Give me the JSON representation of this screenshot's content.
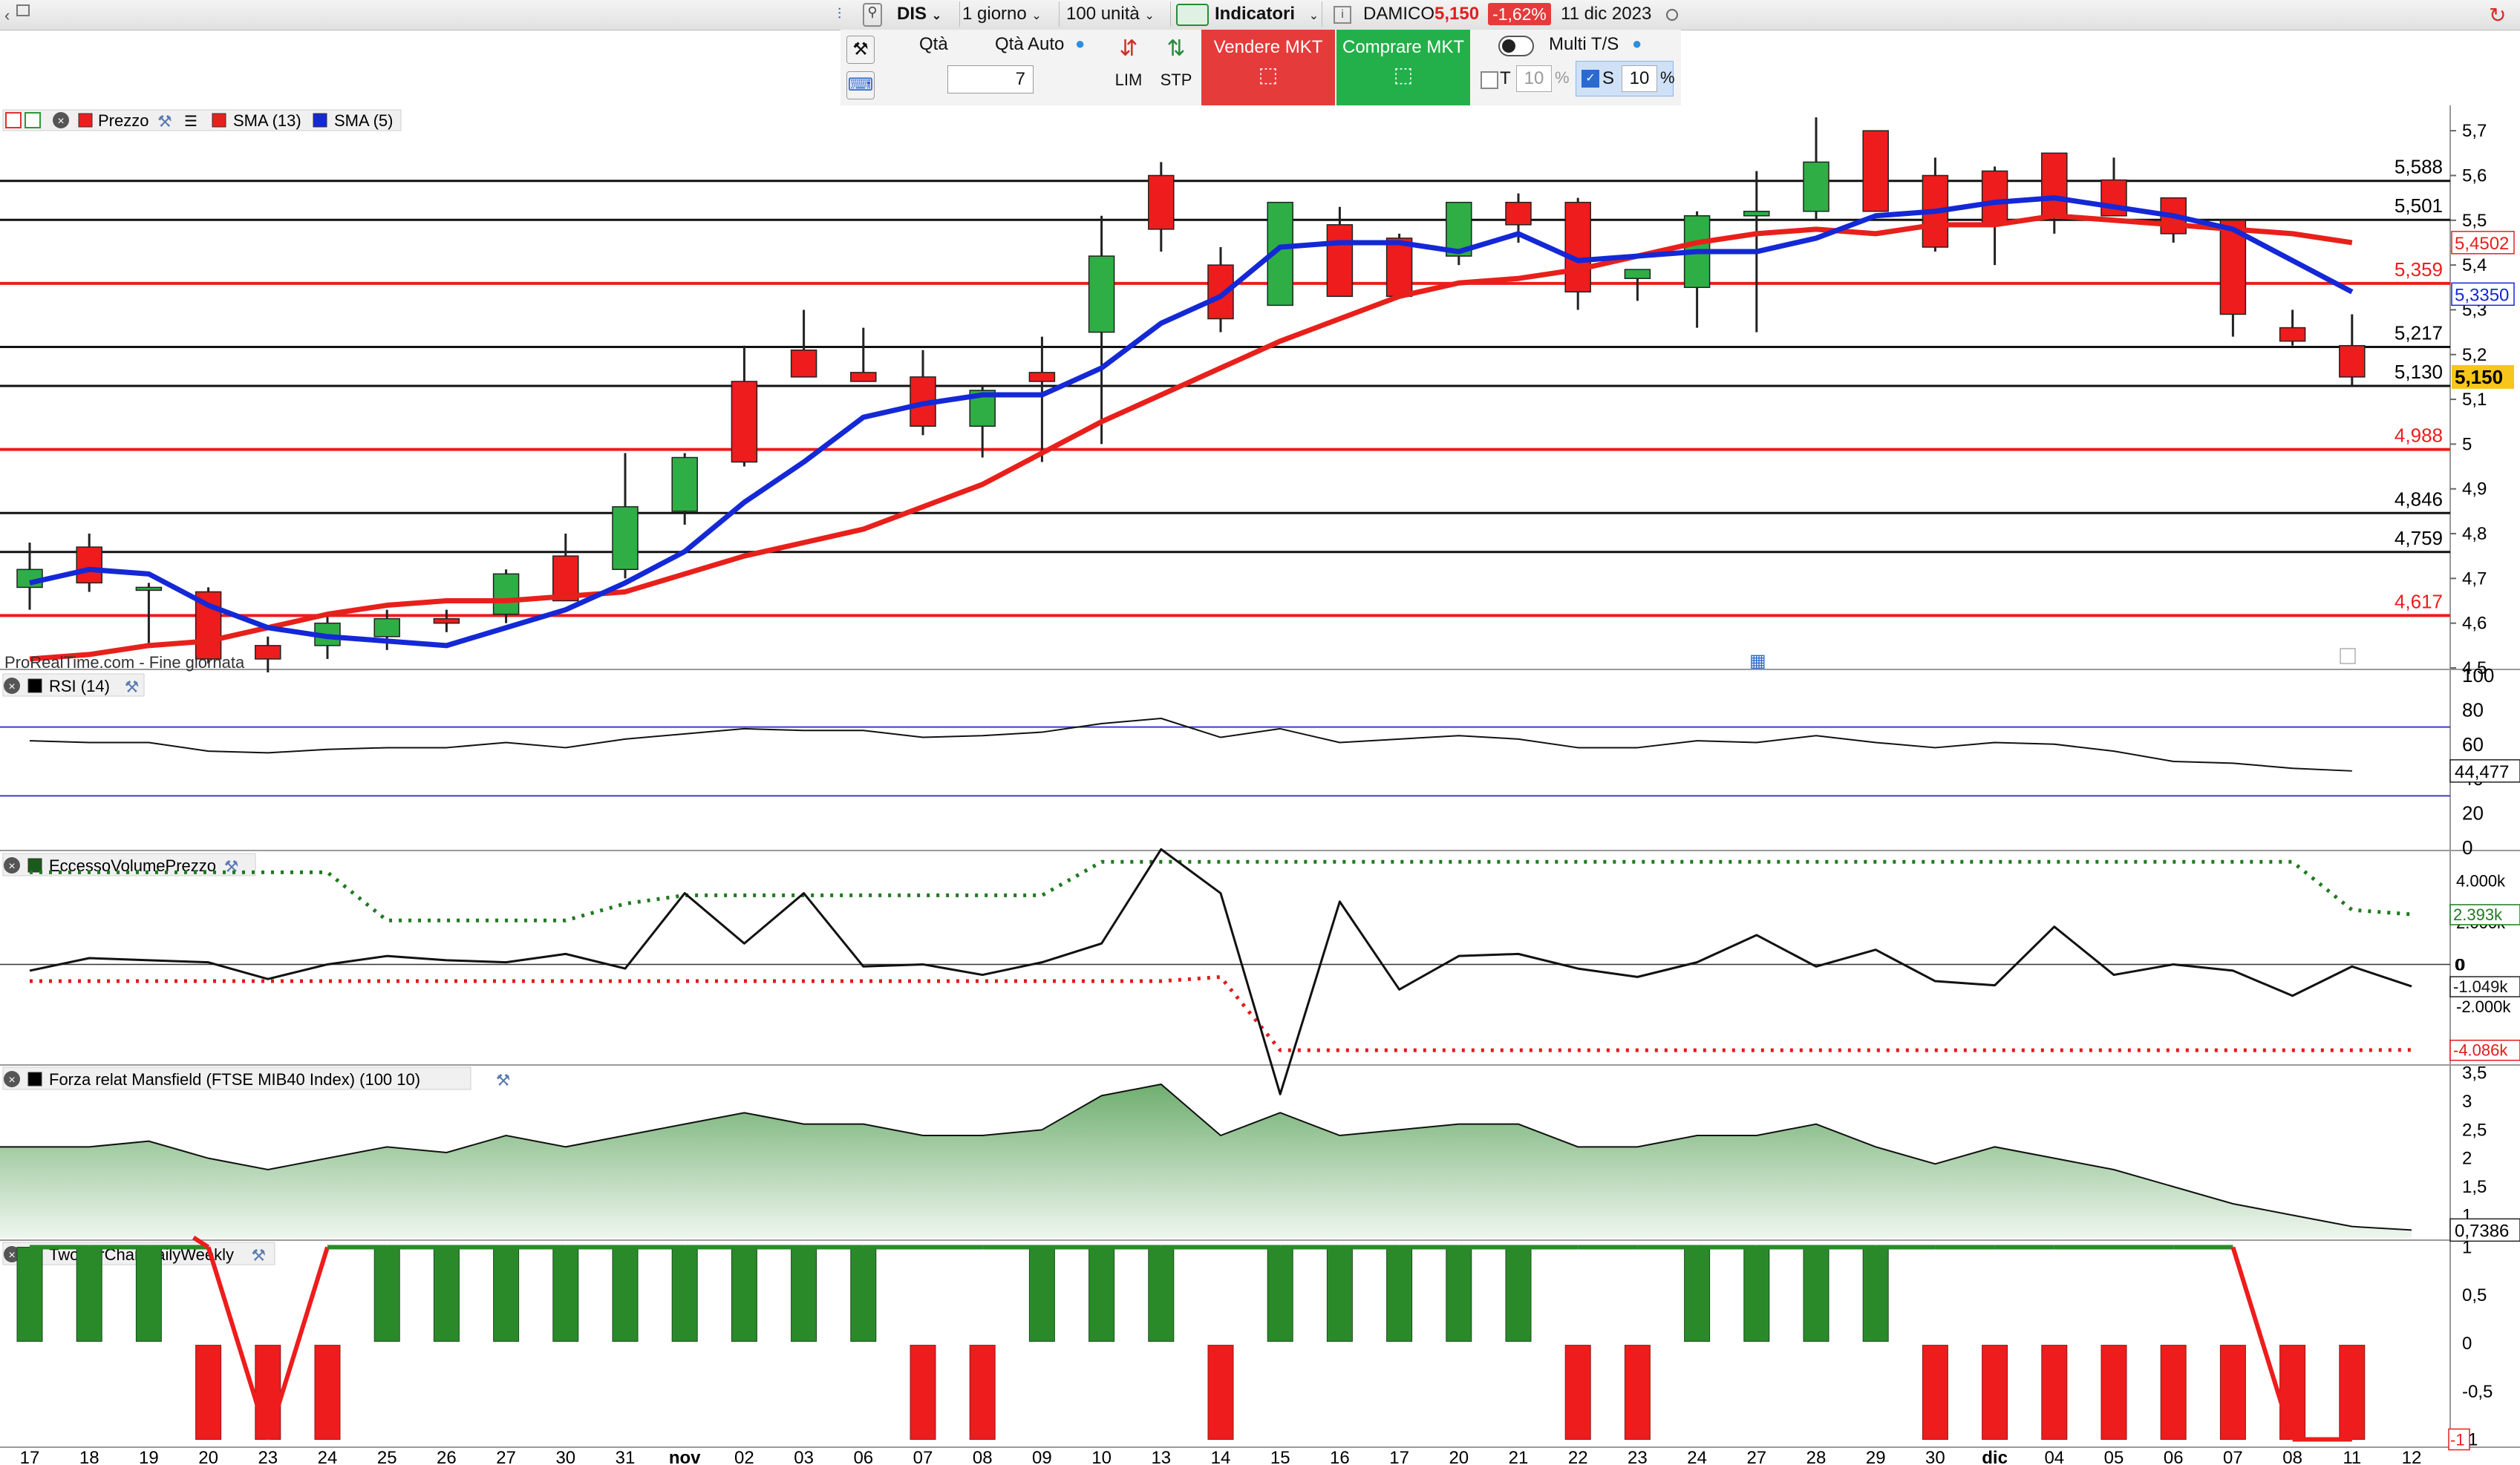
{
  "toolbar": {
    "symbol": "DIS",
    "timeframe": "1 giorno",
    "units": "100 unità",
    "indicators_label": "Indicatori",
    "broker": "DAMICO",
    "last_price": "5,150",
    "change_pct": "-1,62%",
    "date": "11 dic 2023"
  },
  "order_panel": {
    "qty_label": "Qtà",
    "qty_auto_label": "Qtà Auto",
    "qty_value": "7",
    "lim_label": "LIM",
    "stp_label": "STP",
    "sell_label": "Vendere MKT",
    "buy_label": "Comprare MKT",
    "multi_label": "Multi T/S",
    "t_label": "T",
    "t_value": "10",
    "s_label": "S",
    "s_value": "10",
    "pct": "%"
  },
  "panels": {
    "price_legend": [
      "Prezzo",
      "SMA (13)",
      "SMA (5)"
    ],
    "watermark": "ProRealTime.com - Fine giornata",
    "rsi_legend": "RSI (14)",
    "evp_legend": "EccessoVolumePrezzo",
    "mansfield_legend": "Forza relat Mansfield (FTSE MIB40 Index) (100 10)",
    "twobar_legend": "TwoBarChartDailyWeekly"
  },
  "chart_data": [
    {
      "type": "candlestick",
      "x_labels": [
        "17",
        "18",
        "19",
        "20",
        "23",
        "24",
        "25",
        "26",
        "27",
        "30",
        "31",
        "nov",
        "02",
        "03",
        "06",
        "07",
        "08",
        "09",
        "10",
        "13",
        "14",
        "15",
        "16",
        "17",
        "20",
        "21",
        "22",
        "23",
        "24",
        "27",
        "28",
        "29",
        "30",
        "dic",
        "04",
        "05",
        "06",
        "07",
        "08",
        "11",
        "12"
      ],
      "ohlc": [
        [
          4.68,
          4.78,
          4.63,
          4.72
        ],
        [
          4.77,
          4.8,
          4.67,
          4.69
        ],
        [
          4.68,
          4.69,
          4.55,
          4.68
        ],
        [
          4.67,
          4.68,
          4.51,
          4.52
        ],
        [
          4.55,
          4.57,
          4.49,
          4.52
        ],
        [
          4.55,
          4.62,
          4.52,
          4.6
        ],
        [
          4.57,
          4.63,
          4.54,
          4.61
        ],
        [
          4.61,
          4.63,
          4.58,
          4.6
        ],
        [
          4.62,
          4.72,
          4.6,
          4.71
        ],
        [
          4.75,
          4.8,
          4.65,
          4.65
        ],
        [
          4.72,
          4.98,
          4.7,
          4.86
        ],
        [
          4.85,
          4.98,
          4.82,
          4.97
        ],
        [
          5.14,
          5.22,
          4.95,
          4.96
        ],
        [
          5.21,
          5.3,
          5.17,
          5.15
        ],
        [
          5.16,
          5.26,
          5.14,
          5.14
        ],
        [
          5.15,
          5.21,
          5.02,
          5.04
        ],
        [
          5.04,
          5.13,
          4.97,
          5.12
        ],
        [
          5.16,
          5.24,
          4.96,
          5.14
        ],
        [
          5.25,
          5.51,
          5.0,
          5.42
        ],
        [
          5.6,
          5.63,
          5.43,
          5.48
        ],
        [
          5.4,
          5.44,
          5.25,
          5.28
        ],
        [
          5.31,
          5.54,
          5.33,
          5.54
        ],
        [
          5.49,
          5.53,
          5.33,
          5.33
        ],
        [
          5.46,
          5.47,
          5.33,
          5.33
        ],
        [
          5.42,
          5.53,
          5.4,
          5.54
        ],
        [
          5.54,
          5.56,
          5.45,
          5.49
        ],
        [
          5.54,
          5.55,
          5.3,
          5.34
        ],
        [
          5.37,
          5.39,
          5.32,
          5.39
        ],
        [
          5.35,
          5.52,
          5.26,
          5.51
        ],
        [
          5.51,
          5.61,
          5.25,
          5.52
        ],
        [
          5.52,
          5.73,
          5.5,
          5.63
        ],
        [
          5.7,
          5.7,
          5.52,
          5.52
        ],
        [
          5.6,
          5.64,
          5.43,
          5.44
        ],
        [
          5.61,
          5.62,
          5.4,
          5.49
        ],
        [
          5.65,
          5.65,
          5.47,
          5.51
        ],
        [
          5.59,
          5.64,
          5.51,
          5.51
        ],
        [
          5.55,
          5.55,
          5.45,
          5.47
        ],
        [
          5.5,
          5.5,
          5.24,
          5.29
        ],
        [
          5.26,
          5.3,
          5.22,
          5.23
        ],
        [
          5.22,
          5.29,
          5.13,
          5.15
        ]
      ],
      "sma13": [
        4.52,
        4.53,
        4.55,
        4.56,
        4.59,
        4.62,
        4.64,
        4.65,
        4.65,
        4.66,
        4.67,
        4.71,
        4.75,
        4.78,
        4.81,
        4.86,
        4.91,
        4.98,
        5.05,
        5.11,
        5.17,
        5.23,
        5.28,
        5.33,
        5.36,
        5.37,
        5.39,
        5.42,
        5.45,
        5.47,
        5.48,
        5.47,
        5.49,
        5.49,
        5.51,
        5.5,
        5.49,
        5.48,
        5.47,
        5.45
      ],
      "sma5": [
        4.69,
        4.72,
        4.71,
        4.64,
        4.59,
        4.57,
        4.56,
        4.55,
        4.59,
        4.63,
        4.69,
        4.76,
        4.87,
        4.96,
        5.06,
        5.09,
        5.11,
        5.11,
        5.17,
        5.27,
        5.33,
        5.44,
        5.45,
        5.45,
        5.43,
        5.47,
        5.41,
        5.42,
        5.43,
        5.43,
        5.46,
        5.51,
        5.52,
        5.54,
        5.55,
        5.53,
        5.51,
        5.48,
        5.41,
        5.34
      ],
      "levels_black": [
        "5,588",
        "5,501",
        "5,217",
        "5,130",
        "4,846",
        "4,759"
      ],
      "levels_red": [
        "5,359",
        "4,988",
        "4,617"
      ],
      "y_ticks": [
        "5,7",
        "5,6",
        "5,5",
        "5,4",
        "5,3",
        "5,2",
        "5,1",
        "5",
        "4,9",
        "4,8",
        "4,7",
        "4,6",
        "4,5"
      ],
      "sma13_label": "5,4502",
      "sma5_label": "5,3350",
      "last_label": "5,150",
      "ylim": [
        4.5,
        5.75
      ]
    },
    {
      "type": "line",
      "name": "RSI (14)",
      "values": [
        62,
        61,
        61,
        56,
        55,
        57,
        58,
        58,
        61,
        58,
        63,
        66,
        69,
        68,
        68,
        64,
        65,
        67,
        72,
        75,
        64,
        69,
        61,
        63,
        65,
        63,
        58,
        58,
        62,
        61,
        65,
        61,
        58,
        61,
        60,
        56,
        50,
        49,
        46,
        44.477
      ],
      "y_ticks": [
        "100",
        "80",
        "60",
        "40",
        "20",
        "0"
      ],
      "bands": [
        70,
        30
      ],
      "last_label": "44,477",
      "ylim": [
        0,
        100
      ]
    },
    {
      "type": "line",
      "name": "EccessoVolumePrezzo",
      "values": [
        -0.3,
        0.3,
        0.2,
        0.1,
        -0.7,
        0.0,
        0.4,
        0.2,
        0.1,
        0.5,
        -0.2,
        3.4,
        1.0,
        3.4,
        -0.1,
        0.0,
        -0.5,
        0.1,
        1.0,
        5.5,
        3.4,
        -6.2,
        3.0,
        -1.2,
        0.4,
        0.5,
        -0.2,
        -0.6,
        0.1,
        1.4,
        -0.1,
        0.7,
        -0.8,
        -1.0,
        1.8,
        -0.5,
        0.0,
        -0.3,
        -1.5,
        -0.1,
        -1.049
      ],
      "upper": [
        4.4,
        4.4,
        4.4,
        4.4,
        4.4,
        4.4,
        2.1,
        2.1,
        2.1,
        2.1,
        2.9,
        3.3,
        3.3,
        3.3,
        3.3,
        3.3,
        3.3,
        3.3,
        4.9,
        4.9,
        4.9,
        4.9,
        4.9,
        4.9,
        4.9,
        4.9,
        4.9,
        4.9,
        4.9,
        4.9,
        4.9,
        4.9,
        4.9,
        4.9,
        4.9,
        4.9,
        4.9,
        4.9,
        4.9,
        2.6,
        2.393
      ],
      "lower": [
        -0.8,
        -0.8,
        -0.8,
        -0.8,
        -0.8,
        -0.8,
        -0.8,
        -0.8,
        -0.8,
        -0.8,
        -0.8,
        -0.8,
        -0.8,
        -0.8,
        -0.8,
        -0.8,
        -0.8,
        -0.8,
        -0.8,
        -0.8,
        -0.6,
        -4.1,
        -4.1,
        -4.1,
        -4.1,
        -4.1,
        -4.1,
        -4.1,
        -4.1,
        -4.1,
        -4.1,
        -4.1,
        -4.1,
        -4.1,
        -4.1,
        -4.1,
        -4.1,
        -4.1,
        -4.1,
        -4.1,
        -4.086
      ],
      "y_ticks": [
        "4.000k",
        "2.000k",
        "0",
        "-2.000k"
      ],
      "labels": {
        "upper": "2.393k",
        "zero": "0",
        "value": "-1.049k",
        "lower": "-4.086k"
      },
      "ylim": [
        -4.7,
        5.3
      ]
    },
    {
      "type": "area",
      "name": "Forza relat Mansfield (FTSE MIB40 Index) (100 10)",
      "values": [
        2.2,
        2.2,
        2.3,
        2.0,
        1.8,
        2.0,
        2.2,
        2.1,
        2.4,
        2.2,
        2.4,
        2.6,
        2.8,
        2.6,
        2.6,
        2.4,
        2.4,
        2.5,
        3.1,
        3.3,
        2.4,
        2.8,
        2.4,
        2.5,
        2.6,
        2.6,
        2.2,
        2.2,
        2.4,
        2.4,
        2.6,
        2.2,
        1.9,
        2.2,
        2.0,
        1.8,
        1.5,
        1.2,
        1.0,
        0.8,
        0.7386
      ],
      "y_ticks": [
        "3,5",
        "3",
        "2,5",
        "2",
        "1,5",
        "1"
      ],
      "last_label": "0,7386",
      "ylim": [
        0.6,
        3.6
      ]
    },
    {
      "type": "bar",
      "name": "TwoBarChartDailyWeekly",
      "bars": [
        1,
        1,
        1,
        -1,
        -1,
        -1,
        1,
        1,
        1,
        1,
        1,
        1,
        1,
        1,
        1,
        -1,
        -1,
        1,
        1,
        1,
        -1,
        1,
        1,
        1,
        1,
        1,
        -1,
        -1,
        1,
        1,
        1,
        1,
        -1,
        -1,
        -1,
        -1,
        -1,
        -1,
        -1,
        -1
      ],
      "line": [
        1,
        1,
        1,
        1,
        -1,
        1,
        1,
        1,
        1,
        1,
        1,
        1,
        1,
        1,
        1,
        1,
        1,
        1,
        1,
        1,
        1,
        1,
        1,
        1,
        1,
        1,
        1,
        1,
        1,
        1,
        1,
        1,
        1,
        1,
        1,
        1,
        1,
        1,
        -1,
        -1
      ],
      "y_ticks": [
        "1",
        "0,5",
        "0",
        "-0,5",
        "-1"
      ],
      "ylim": [
        -1.05,
        1.05
      ]
    }
  ],
  "colors": {
    "up": "#2fae45",
    "down": "#ee1c1c",
    "sma13": "#e8201b",
    "sma5": "#1428d6",
    "accent_buy": "#23b04a",
    "accent_sell": "#e53b3b"
  }
}
